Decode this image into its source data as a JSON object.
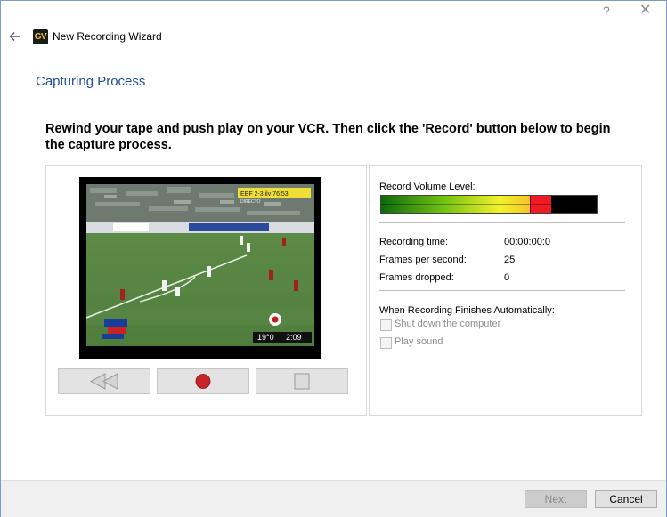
{
  "window": {
    "help_glyph": "?",
    "close_glyph": "✕",
    "app_icon_text": "GV",
    "title": "New Recording Wizard"
  },
  "page": {
    "title": "Capturing Process",
    "instruction": "Rewind your tape and push play on your VCR. Then click the 'Record' button below to begin the capture process."
  },
  "video": {
    "scoreboard": "EBF 2-3 ilv  76:53",
    "scoreboard_sub": "DIRECTO",
    "time_left": "19°0",
    "time_right": "2:09"
  },
  "recording": {
    "volume_label": "Record Volume Level:",
    "volume_level": 0.79,
    "recording_time_label": "Recording time:",
    "recording_time_value": "00:00:00:0",
    "fps_label": "Frames per second:",
    "fps_value": "25",
    "frames_dropped_label": "Frames dropped:",
    "frames_dropped_value": "0",
    "when_finishes_label": "When Recording Finishes Automatically:",
    "shutdown_label": "Shut down the computer",
    "play_sound_label": "Play sound"
  },
  "footer": {
    "next_label": "Next",
    "cancel_label": "Cancel"
  },
  "colors": {
    "accent_title": "#1f4e9c",
    "record_red": "#c8252b"
  }
}
